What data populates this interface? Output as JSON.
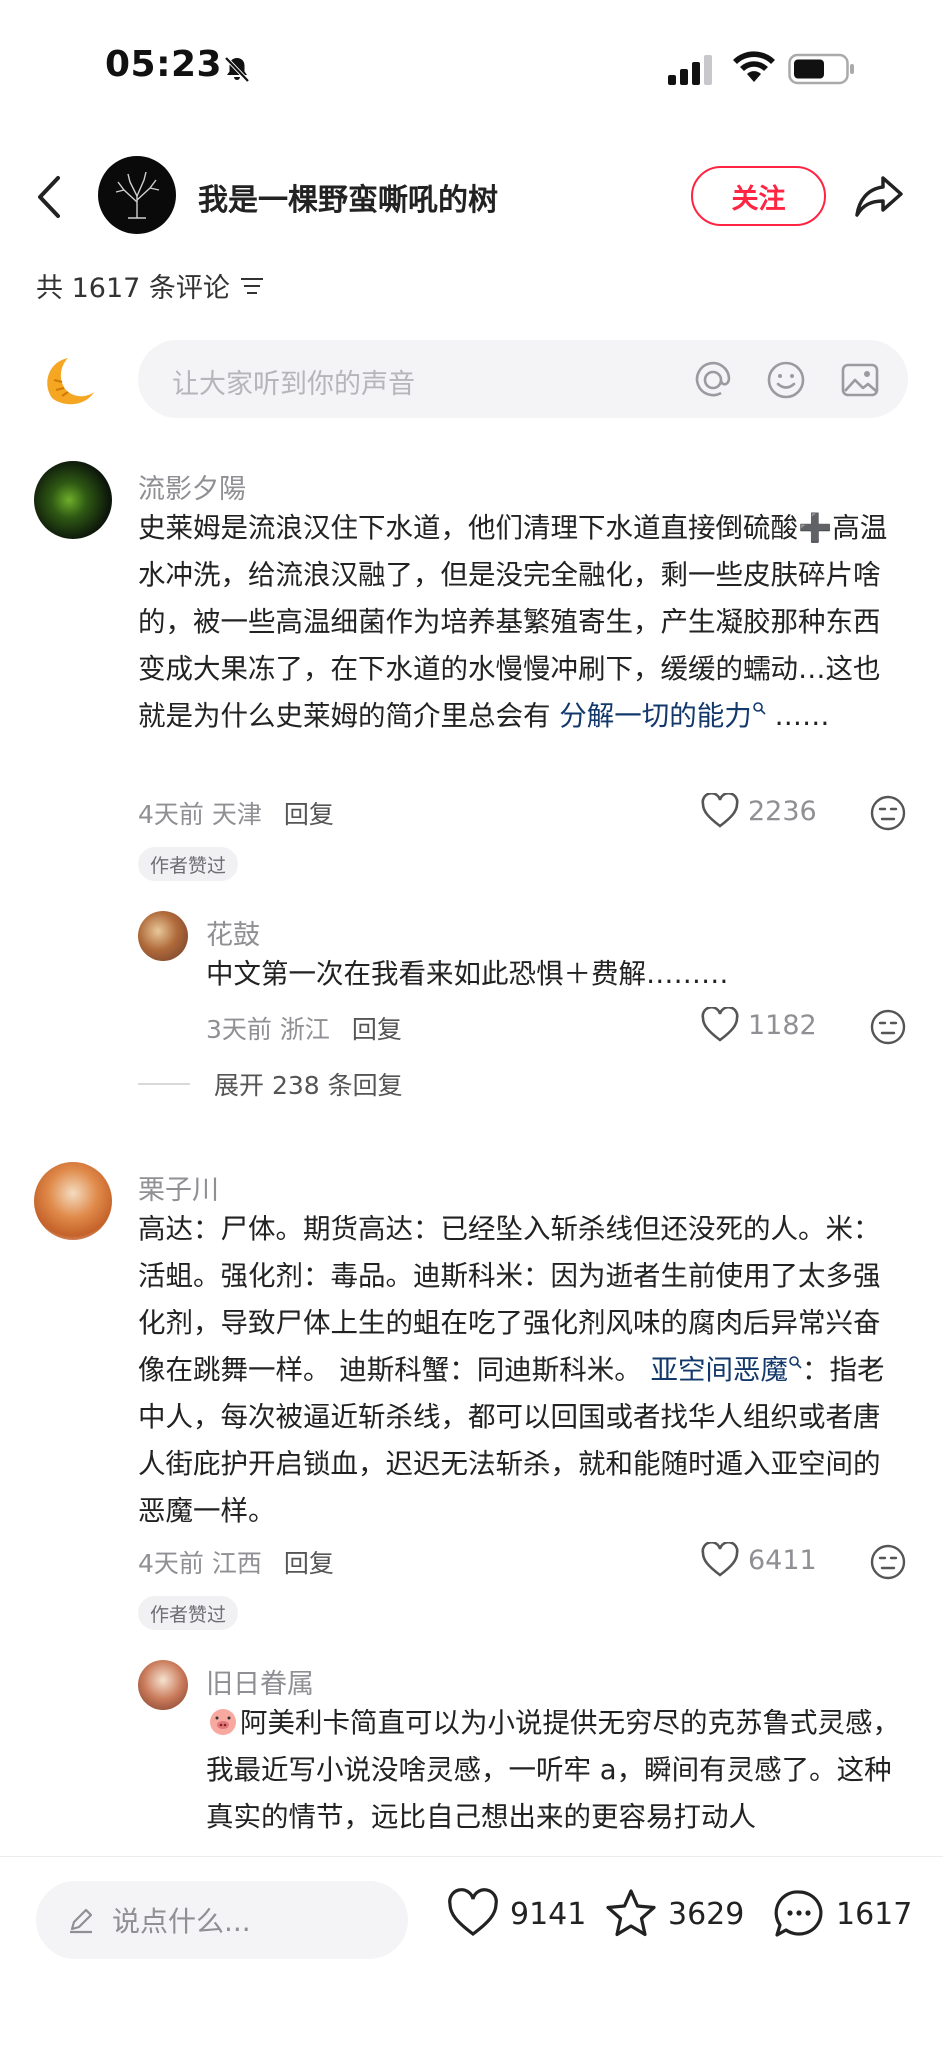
{
  "status": {
    "time": "05:23"
  },
  "header": {
    "author_name": "我是一棵野蛮嘶吼的树",
    "follow_label": "关注"
  },
  "comment_count": "共 1617 条评论",
  "composer": {
    "placeholder": "让大家听到你的声音"
  },
  "comments": [
    {
      "user": "流影夕陽",
      "text_before": "史莱姆是流浪汉住下水道，他们清理下水道直接倒硫酸➕高温水冲洗，给流浪汉融了，但是没完全融化，剩一些皮肤碎片啥的，被一些高温细菌作为培养基繁殖寄生，产生凝胶那种东西变成大果冻了，在下水道的水慢慢冲刷下，缓缓的蠕动…这也就是为什么史莱姆的简介里总会有 ",
      "link": "分解一切的能力",
      "text_after": " ……",
      "time": "4天前",
      "location": "天津",
      "reply_label": "回复",
      "likes": "2236",
      "badge": "作者赞过",
      "replies": [
        {
          "user": "花鼓",
          "text": "中文第一次在我看来如此恐惧＋费解………",
          "time": "3天前",
          "location": "浙江",
          "reply_label": "回复",
          "likes": "1182"
        }
      ],
      "expand_label": "展开 238 条回复"
    },
    {
      "user": "栗子川",
      "text_before": "高达：尸体。期货高达：已经坠入斩杀线但还没死的人。米：活蛆。强化剂：毒品。迪斯科米：因为逝者生前使用了太多强化剂，导致尸体上生的蛆在吃了强化剂风味的腐肉后异常兴奋像在跳舞一样。 迪斯科蟹：同迪斯科米。 ",
      "link": "亚空间恶魔",
      "text_after": "：指老中人，每次被逼近斩杀线，都可以回国或者找华人组织或者唐人街庇护开启锁血，迟迟无法斩杀，就和能随时遁入亚空间的恶魔一样。",
      "time": "4天前",
      "location": "江西",
      "reply_label": "回复",
      "likes": "6411",
      "badge": "作者赞过",
      "replies": [
        {
          "user": "旧日眷属",
          "text": "阿美利卡简直可以为小说提供无穷尽的克苏鲁式灵感，我最近写小说没啥灵感，一听牢 a，瞬间有灵感了。这种真实的情节，远比自己想出来的更容易打动人"
        }
      ]
    }
  ],
  "bottom_bar": {
    "say_placeholder": "说点什么...",
    "likes": "9141",
    "favorites": "3629",
    "comments": "1617"
  },
  "colors": {
    "accent": "#ff2442",
    "link": "#13386c",
    "muted": "#8f8f94"
  }
}
